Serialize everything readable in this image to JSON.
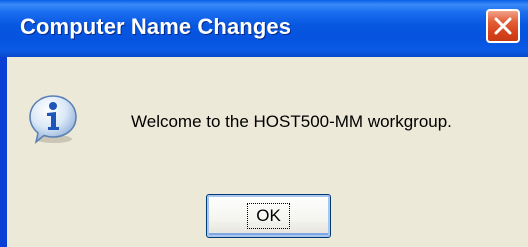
{
  "window": {
    "title": "Computer Name Changes",
    "close_label": "Close"
  },
  "dialog": {
    "icon": "info-icon",
    "message": "Welcome to the HOST500-MM workgroup.",
    "ok_label": "OK"
  },
  "colors": {
    "titlebar": "#0757e0",
    "client_background": "#ece9d8",
    "close_button": "#d8431c"
  }
}
